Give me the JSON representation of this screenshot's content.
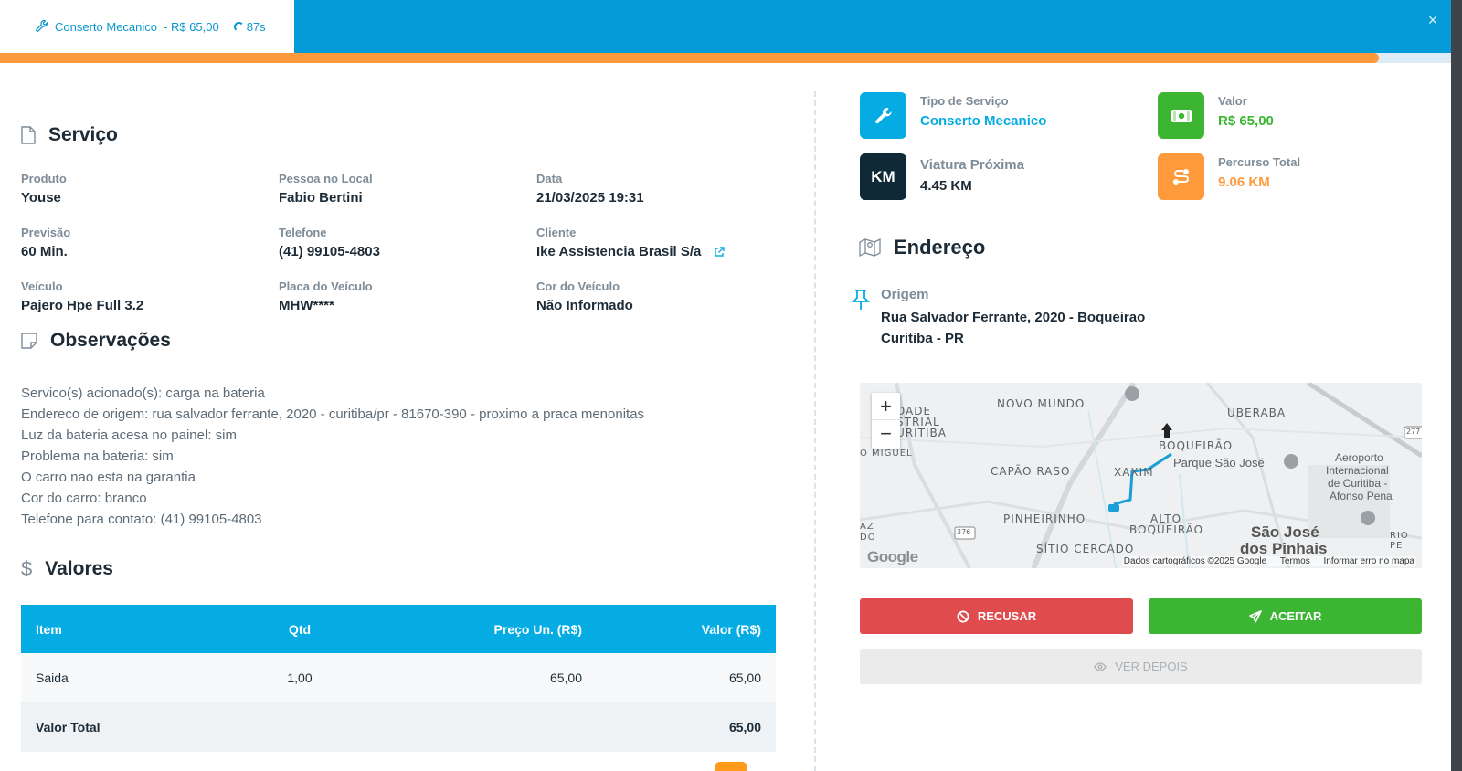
{
  "header": {
    "service_name": "Conserto Mecanico",
    "service_price": "- R$ 65,00",
    "timer": "87s",
    "close_label": "×",
    "timer_progress_percent": 95
  },
  "servico": {
    "title": "Serviço",
    "fields": [
      {
        "label": "Produto",
        "value": "Youse"
      },
      {
        "label": "Pessoa no Local",
        "value": "Fabio Bertini"
      },
      {
        "label": "Data",
        "value": "21/03/2025 19:31"
      },
      {
        "label": "Previsão",
        "value": "60 Min."
      },
      {
        "label": "Telefone",
        "value": "(41) 99105-4803"
      },
      {
        "label": "Cliente",
        "value": "Ike Assistencia Brasil S/a"
      },
      {
        "label": "Veículo",
        "value": "Pajero Hpe Full 3.2"
      },
      {
        "label": "Placa do Veículo",
        "value": "MHW****"
      },
      {
        "label": "Cor do Veículo",
        "value": "Não Informado"
      }
    ]
  },
  "observacoes": {
    "title": "Observações",
    "lines": [
      "Servico(s) acionado(s): carga na bateria",
      "Endereco de origem: rua salvador ferrante, 2020 - curitiba/pr - 81670-390 - proximo a praca menonitas",
      "Luz da bateria acesa no painel: sim",
      "Problema na bateria: sim",
      "O carro nao esta na garantia",
      "Cor do carro: branco",
      "Telefone para contato: (41) 99105-4803"
    ]
  },
  "valores": {
    "title": "Valores",
    "columns": [
      "Item",
      "Qtd",
      "Preço Un. (R$)",
      "Valor (R$)"
    ],
    "rows": [
      {
        "item": "Saida",
        "qtd": "1,00",
        "preco": "65,00",
        "valor": "65,00"
      }
    ],
    "total_label": "Valor Total",
    "total_value": "65,00"
  },
  "summary": {
    "tipo_label": "Tipo de Serviço",
    "tipo_value": "Conserto Mecanico",
    "valor_label": "Valor",
    "valor_value": "R$ 65,00",
    "viatura_label": "Viatura Próxima",
    "viatura_value": "4.45 KM",
    "viatura_icon_text": "KM",
    "percurso_label": "Percurso Total",
    "percurso_value": "9.06 KM"
  },
  "endereco": {
    "title": "Endereço",
    "origem_label": "Origem",
    "origem_line1": "Rua Salvador Ferrante, 2020 - Boqueirao",
    "origem_line2": "Curitiba - PR"
  },
  "map": {
    "zoom_in": "+",
    "zoom_out": "−",
    "logo": "Google",
    "attribution": "Dados cartográficos ©2025 Google",
    "terms": "Termos",
    "report": "Informar erro no mapa",
    "labels": {
      "novo_mundo": "NOVO MUNDO",
      "uberaba": "UBERABA",
      "cidade_industrial": "DADE",
      "cidade_industrial2": "STRIAL",
      "cidade_industrial3": "URITIBA",
      "sao_miguel": "O MIGUEL",
      "capao_raso": "CAPÃO RASO",
      "xaxim": "XAXIM",
      "boqueirao": "BOQUEIRÃO",
      "parque_sao_jose": "Parque São José",
      "aeroporto1": "Aeroporto",
      "aeroporto2": "Internacional",
      "aeroporto3": "de Curitiba -",
      "aeroporto4": "Afonso Pena",
      "pinheirinho": "PINHEIRINHO",
      "alto1": "ALTO",
      "alto2": "BOQUEIRÃO",
      "sitio_cercado": "SÍTIO CERCADO",
      "sjp1": "São José",
      "sjp2": "dos Pinhais",
      "rio_pe": "RIO PE",
      "az": "AZ",
      "do": "DO",
      "road_277": "277",
      "road_376": "376"
    }
  },
  "actions": {
    "recusar": "RECUSAR",
    "aceitar": "ACEITAR",
    "ver_depois": "VER DEPOIS"
  },
  "colors": {
    "primary": "#049bd8",
    "accent_orange": "#ff9a3c",
    "success": "#3cb532",
    "danger": "#e04b4e",
    "dark_tile": "#0f2a36"
  }
}
